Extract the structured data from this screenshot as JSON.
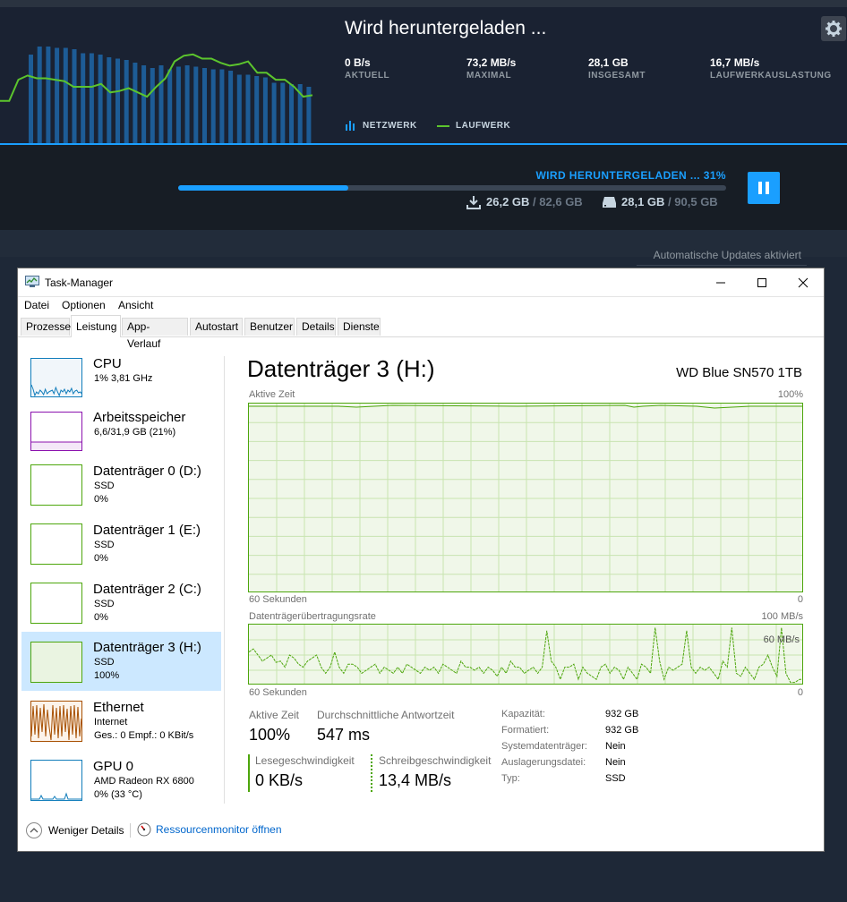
{
  "steam": {
    "title": "Wird heruntergeladen ...",
    "stats": [
      {
        "value": "0 B/s",
        "label": "AKTUELL"
      },
      {
        "value": "73,2 MB/s",
        "label": "MAXIMAL"
      },
      {
        "value": "28,1 GB",
        "label": "INSGESAMT"
      },
      {
        "value": "16,7 MB/s",
        "label": "LAUFWERKAUSLASTUNG"
      }
    ],
    "legend": {
      "network": "NETZWERK",
      "disk": "LAUFWERK"
    },
    "progress_label": "WIRD HERUNTERGELADEN ... 31%",
    "progress_fraction": 0.31,
    "downloaded": "26,2 GB",
    "download_total": "82,6 GB",
    "disk_written": "28,1 GB",
    "disk_total": "90,5 GB",
    "auto_updates": "Automatische Updates aktiviert",
    "network_bars": [
      0.66,
      0.72,
      0.72,
      0.71,
      0.71,
      0.7,
      0.67,
      0.67,
      0.66,
      0.64,
      0.63,
      0.62,
      0.6,
      0.58,
      0.56,
      0.58,
      0.55,
      0.57,
      0.58,
      0.57,
      0.56,
      0.55,
      0.55,
      0.54,
      0.51,
      0.51,
      0.5,
      0.49,
      0.45,
      0.45,
      0.44,
      0.44,
      0.42
    ],
    "disk_line": [
      0.3,
      0.3,
      0.45,
      0.48,
      0.46,
      0.46,
      0.45,
      0.44,
      0.4,
      0.4,
      0.4,
      0.42,
      0.36,
      0.37,
      0.39,
      0.36,
      0.33,
      0.4,
      0.46,
      0.58,
      0.62,
      0.63,
      0.6,
      0.6,
      0.57,
      0.55,
      0.56,
      0.58,
      0.5,
      0.5,
      0.45,
      0.45,
      0.4,
      0.33,
      0.34
    ]
  },
  "tm": {
    "title": "Task-Manager",
    "menu": [
      "Datei",
      "Optionen",
      "Ansicht"
    ],
    "tabs": [
      "Prozesse",
      "Leistung",
      "App-Verlauf",
      "Autostart",
      "Benutzer",
      "Details",
      "Dienste"
    ],
    "left": [
      {
        "name": "CPU",
        "sub1": "1% 3,81 GHz",
        "sub2": "",
        "color": "#117dbb"
      },
      {
        "name": "Arbeitsspeicher",
        "sub1": "6,6/31,9 GB (21%)",
        "sub2": "",
        "color": "#8b12ae"
      },
      {
        "name": "Datenträger 0 (D:)",
        "sub1": "SSD",
        "sub2": "0%",
        "color": "#4da60c"
      },
      {
        "name": "Datenträger 1 (E:)",
        "sub1": "SSD",
        "sub2": "0%",
        "color": "#4da60c"
      },
      {
        "name": "Datenträger 2 (C:)",
        "sub1": "SSD",
        "sub2": "0%",
        "color": "#4da60c"
      },
      {
        "name": "Datenträger 3 (H:)",
        "sub1": "SSD",
        "sub2": "100%",
        "color": "#4da60c"
      },
      {
        "name": "Ethernet",
        "sub1": "Internet",
        "sub2": "Ges.: 0 Empf.: 0 KBit/s",
        "color": "#a74f01"
      },
      {
        "name": "GPU 0",
        "sub1": "AMD Radeon RX 6800",
        "sub2": "0% (33 °C)",
        "color": "#117dbb"
      }
    ],
    "right": {
      "title": "Datenträger 3 (H:)",
      "model": "WD Blue SN570 1TB",
      "graph1_label": "Aktive Zeit",
      "graph1_max": "100%",
      "graph1_xlabel": "60 Sekunden",
      "graph1_xmin": "0",
      "graph2_label": "Datenträgerübertragungsrate",
      "graph2_max": "100 MB/s",
      "graph2_mid": "60 MB/s",
      "graph2_xlabel": "60 Sekunden",
      "graph2_xmin": "0",
      "active_time_label": "Aktive Zeit",
      "active_time_value": "100%",
      "resp_label": "Durchschnittliche Antwortzeit",
      "resp_value": "547 ms",
      "read_label": "Lesegeschwindigkeit",
      "read_value": "0 KB/s",
      "write_label": "Schreibgeschwindigkeit",
      "write_value": "13,4 MB/s",
      "props": [
        {
          "k": "Kapazität:",
          "v": "932 GB"
        },
        {
          "k": "Formatiert:",
          "v": "932 GB"
        },
        {
          "k": "Systemdatenträger:",
          "v": "Nein"
        },
        {
          "k": "Auslagerungsdatei:",
          "v": "Nein"
        },
        {
          "k": "Typ:",
          "v": "SSD"
        }
      ],
      "write_rate": [
        0.55,
        0.6,
        0.5,
        0.4,
        0.45,
        0.5,
        0.38,
        0.4,
        0.3,
        0.5,
        0.45,
        0.35,
        0.3,
        0.4,
        0.45,
        0.5,
        0.3,
        0.2,
        0.3,
        0.55,
        0.3,
        0.2,
        0.35,
        0.35,
        0.3,
        0.2,
        0.25,
        0.3,
        0.35,
        0.2,
        0.3,
        0.25,
        0.2,
        0.3,
        0.2,
        0.35,
        0.3,
        0.25,
        0.2,
        0.3,
        0.25,
        0.3,
        0.2,
        0.35,
        0.3,
        0.25,
        0.2,
        0.4,
        0.3,
        0.3,
        0.25,
        0.3,
        0.2,
        0.3,
        0.25,
        0.15,
        0.3,
        0.2,
        0.4,
        0.3,
        0.3,
        0.2,
        0.25,
        0.3,
        0.2,
        0.3,
        0.9,
        0.4,
        0.3,
        0.1,
        0.3,
        0.3,
        0.35,
        0.1,
        0.3,
        0.2,
        0.15,
        0.1,
        0.3,
        0.35,
        0.2,
        0.3,
        0.25,
        0.1,
        0.3,
        0.2,
        0.1,
        0.35,
        0.3,
        0.2,
        0.95,
        0.4,
        0.1,
        0.3,
        0.25,
        0.3,
        0.35,
        0.9,
        0.3,
        0.2,
        0.3,
        0.25,
        0.3,
        0.2,
        0.1,
        0.4,
        0.3,
        0.95,
        0.2,
        0.15,
        0.3,
        0.2,
        0.1,
        0.3,
        0.35,
        0.5,
        0.3,
        0.15,
        0.95,
        0.2,
        0.05,
        0.05,
        0.1,
        0.1
      ]
    },
    "footer": {
      "less": "Weniger Details",
      "monitor": "Ressourcenmonitor öffnen"
    }
  }
}
